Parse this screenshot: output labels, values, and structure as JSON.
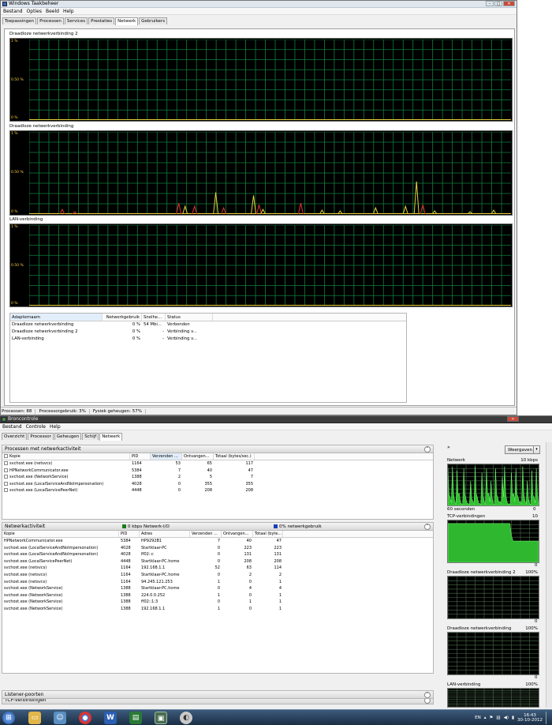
{
  "task_manager": {
    "title": "Windows Taakbeheer",
    "menu": [
      "Bestand",
      "Opties",
      "Beeld",
      "Help"
    ],
    "tabs": [
      "Toepassingen",
      "Processen",
      "Services",
      "Prestaties",
      "Netwerk",
      "Gebruikers"
    ],
    "active_tab": 4,
    "graphs": [
      {
        "label": "Draadloze netwerkverbinding 2",
        "y_ticks": [
          "1 %",
          "0.50 %",
          "0 %"
        ]
      },
      {
        "label": "Draadloze netwerkverbinding",
        "y_ticks": [
          "1 %",
          "0.50 %",
          "0 %"
        ]
      },
      {
        "label": "LAN-verbinding",
        "y_ticks": [
          "1 %",
          "0.50 %",
          "0 %"
        ]
      }
    ],
    "adapter_table": {
      "headers": [
        "Adapternaam",
        "Netwerkgebruik",
        "Snelhe...",
        "Status"
      ],
      "rows": [
        [
          "Draadloze netwerkverbinding",
          "0 %",
          "54 Mbi...",
          "Verbonden"
        ],
        [
          "Draadloze netwerkverbinding 2",
          "0 %",
          "-",
          "Verbinding v..."
        ],
        [
          "LAN-verbinding",
          "0 %",
          "-",
          "Verbinding v..."
        ]
      ]
    },
    "status": {
      "processes": "Processen: 88",
      "cpu": "Processorgebruik: 3%",
      "memory": "Fysiek geheugen: 57%"
    }
  },
  "resource_monitor": {
    "title": "Broncontrole",
    "menu": [
      "Bestand",
      "Controle",
      "Help"
    ],
    "tabs": [
      "Overzicht",
      "Processor",
      "Geheugen",
      "Schijf",
      "Netwerk"
    ],
    "active_tab": 4,
    "processes_section": {
      "title": "Processen met netwerkactiviteit",
      "headers": [
        "Kopie",
        "PID",
        "Verzenden ...",
        "Ontvangen...",
        "Totaal (bytes/sec.)"
      ],
      "rows": [
        [
          "svchost.exe (netsvcs)",
          "1164",
          "53",
          "65",
          "117"
        ],
        [
          "HPNetworkCommunicator.exe",
          "5384",
          "7",
          "40",
          "47"
        ],
        [
          "svchost.exe (NetworkService)",
          "1388",
          "2",
          "5",
          "7"
        ],
        [
          "svchost.exe (LocalServiceAndNoImpersonation)",
          "4028",
          "0",
          "355",
          "355"
        ],
        [
          "svchost.exe (LocalServicePeerNet)",
          "4448",
          "0",
          "208",
          "208"
        ]
      ]
    },
    "network_section": {
      "title": "Netwerkactiviteit",
      "io_label": "0 kbps  Netwerk-I/O",
      "usage_label": "0% netwerkgebruik",
      "io_color": "#1a7d1a",
      "usage_color": "#1b3fb8",
      "headers": [
        "Kopie",
        "PID",
        "Adres",
        "Verzenden ...",
        "Ontvangen...",
        "Totaal (byte..."
      ],
      "rows": [
        [
          "HPNetworkCommunicator.exe",
          "5384",
          "HP9292B1",
          "7",
          "40",
          "47"
        ],
        [
          "svchost.exe (LocalServiceAndNoImpersonation)",
          "4028",
          "Startklaar-PC",
          "0",
          "223",
          "223"
        ],
        [
          "svchost.exe (LocalServiceAndNoImpersonation)",
          "4028",
          "ff02::c",
          "0",
          "131",
          "131"
        ],
        [
          "svchost.exe (LocalServicePeerNet)",
          "4448",
          "Startklaar-PC.home",
          "0",
          "208",
          "208"
        ],
        [
          "svchost.exe (netsvcs)",
          "1164",
          "192.168.1.1",
          "52",
          "63",
          "114"
        ],
        [
          "svchost.exe (netsvcs)",
          "1164",
          "Startklaar-PC.home",
          "0",
          "2",
          "2"
        ],
        [
          "svchost.exe (netsvcs)",
          "1164",
          "94.245.121.253",
          "1",
          "0",
          "1"
        ],
        [
          "svchost.exe (NetworkService)",
          "1388",
          "Startklaar-PC.home",
          "0",
          "4",
          "4"
        ],
        [
          "svchost.exe (NetworkService)",
          "1388",
          "224.0.0.252",
          "1",
          "0",
          "1"
        ],
        [
          "svchost.exe (NetworkService)",
          "1388",
          "ff02::1:3",
          "0",
          "1",
          "1"
        ],
        [
          "svchost.exe (NetworkService)",
          "1388",
          "192.168.1.1",
          "1",
          "0",
          "1"
        ]
      ]
    },
    "tcp_section": {
      "title": "TCP-verbindingen"
    },
    "listener_section": {
      "title": "Listener-poorten"
    },
    "views_button": "Weergaven",
    "side_graphs": [
      {
        "label": "Netwerk",
        "max": "10 kbps",
        "footer_left": "60 seconden",
        "footer_right": "0"
      },
      {
        "label": "TCP-verbindingen",
        "max": "10",
        "footer_right": "0"
      },
      {
        "label": "Draadloze netwerkverbinding 2",
        "max": "100%",
        "footer_right": "0"
      },
      {
        "label": "Draadloze netwerkverbinding",
        "max": "100%",
        "footer_right": "0"
      },
      {
        "label": "LAN-verbinding",
        "max": "100%"
      }
    ]
  },
  "taskbar": {
    "language": "EN",
    "time": "16:43",
    "date": "30-10-2012",
    "icons": [
      "windows-start-icon",
      "folder-icon",
      "people-icon",
      "chrome-icon",
      "word-icon",
      "task-manager-icon",
      "monitor-icon",
      "mouse-icon"
    ]
  }
}
